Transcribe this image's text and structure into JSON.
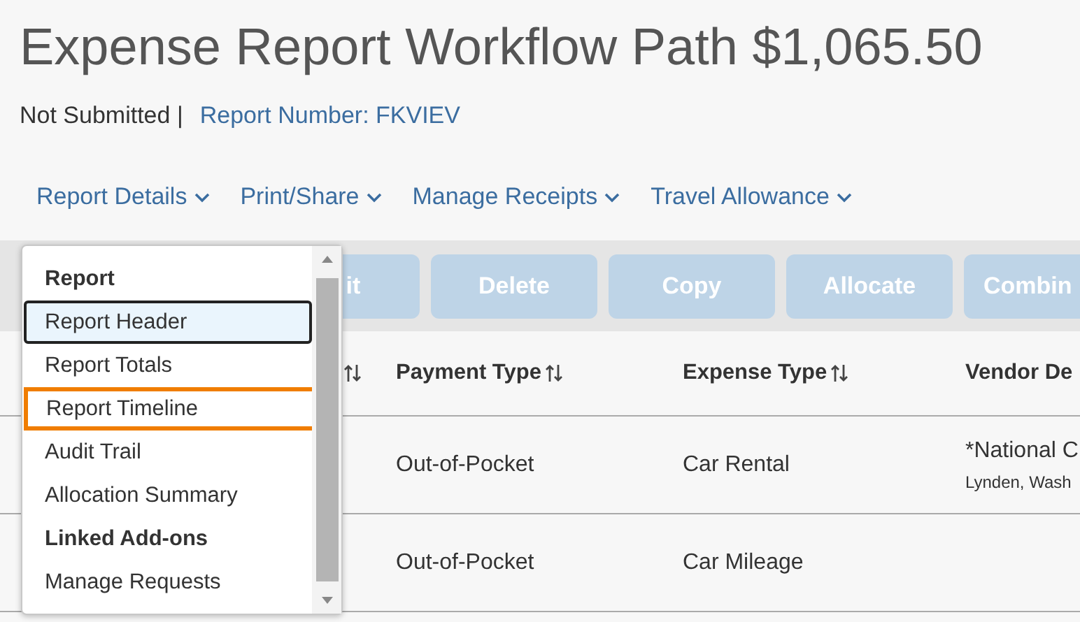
{
  "title": "Expense Report Workflow Path $1,065.50",
  "status": "Not Submitted |",
  "report_number": "Report Number: FKVIEV",
  "nav": [
    {
      "label": "Report Details"
    },
    {
      "label": "Print/Share"
    },
    {
      "label": "Manage Receipts"
    },
    {
      "label": "Travel Allowance"
    }
  ],
  "toolbar": [
    {
      "label": "it",
      "disabled": true
    },
    {
      "label": "Delete",
      "disabled": true
    },
    {
      "label": "Copy",
      "disabled": true
    },
    {
      "label": "Allocate",
      "disabled": true
    },
    {
      "label": "Combin",
      "disabled": true
    }
  ],
  "table": {
    "columns": [
      {
        "sortable": true
      },
      {
        "label": "Payment Type",
        "sortable": true
      },
      {
        "label": "Expense Type",
        "sortable": true
      },
      {
        "label": "Vendor De",
        "sortable": false
      }
    ],
    "rows": [
      {
        "payment_type": "Out-of-Pocket",
        "expense_type": "Car Rental",
        "vendor": "*National C",
        "vendor_location": "Lynden, Wash"
      },
      {
        "payment_type": "Out-of-Pocket",
        "expense_type": "Car Mileage"
      }
    ]
  },
  "dropdown": {
    "items": [
      {
        "kind": "heading",
        "label": "Report"
      },
      {
        "kind": "item",
        "label": "Report Header",
        "selected": true,
        "highlighted": false
      },
      {
        "kind": "item",
        "label": "Report Totals",
        "selected": false,
        "highlighted": false
      },
      {
        "kind": "item",
        "label": "Report Timeline",
        "selected": false,
        "highlighted": true
      },
      {
        "kind": "item",
        "label": "Audit Trail",
        "selected": false,
        "highlighted": false
      },
      {
        "kind": "item",
        "label": "Allocation Summary",
        "selected": false,
        "highlighted": false
      },
      {
        "kind": "heading",
        "label": "Linked Add-ons"
      },
      {
        "kind": "item",
        "label": "Manage Requests",
        "selected": false,
        "highlighted": false
      }
    ]
  }
}
